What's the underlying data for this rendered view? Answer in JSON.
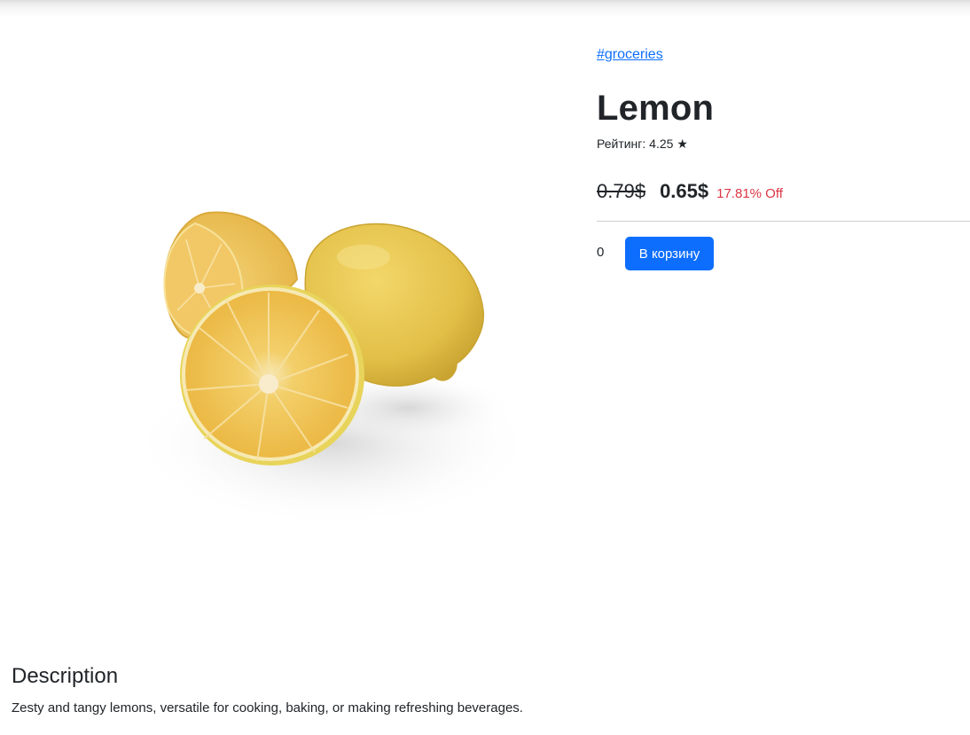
{
  "product": {
    "category_tag": "#groceries",
    "title": "Lemon",
    "rating_text": "Рейтинг: 4.25 ★",
    "old_price": "0.79$",
    "new_price": "0.65$",
    "discount": "17.81% Off",
    "image_alt": "Lemon"
  },
  "cart": {
    "quantity": "0",
    "add_button_label": "В корзину"
  },
  "description": {
    "heading": "Description",
    "text": "Zesty and tangy lemons, versatile for cooking, baking, or making refreshing beverages."
  },
  "colors": {
    "accent": "#0d6efd",
    "discount": "#dc3545",
    "lemon_flesh": "#f1c24a",
    "lemon_peel": "#e8c94e"
  }
}
